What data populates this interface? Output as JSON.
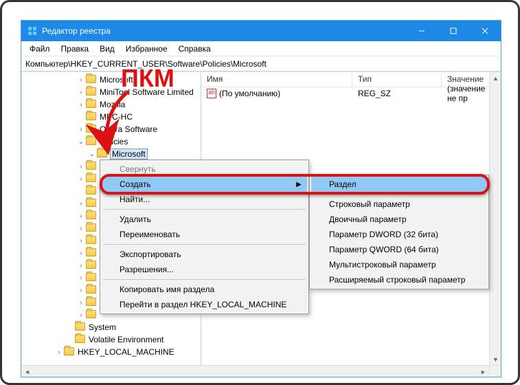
{
  "window": {
    "title": "Редактор реестра",
    "controls": {
      "minimize": "—",
      "maximize": "☐",
      "close": "✕"
    }
  },
  "menubar": [
    "Файл",
    "Правка",
    "Вид",
    "Избранное",
    "Справка"
  ],
  "address": "Компьютер\\HKEY_CURRENT_USER\\Software\\Policies\\Microsoft",
  "tree": [
    {
      "indent": 5,
      "exp": ">",
      "label": "Microsoft"
    },
    {
      "indent": 5,
      "exp": ">",
      "label": "MiniTool Software Limited"
    },
    {
      "indent": 5,
      "exp": ">",
      "label": "Mozilla"
    },
    {
      "indent": 5,
      "exp": "",
      "label": "MPC-HC"
    },
    {
      "indent": 5,
      "exp": ">",
      "label": "Opera Software"
    },
    {
      "indent": 5,
      "exp": "v",
      "label": "Policies"
    },
    {
      "indent": 6,
      "exp": "v",
      "label": "Microsoft",
      "selected": true
    },
    {
      "indent": 5,
      "exp": ">",
      "label": ""
    },
    {
      "indent": 5,
      "exp": ">",
      "label": ""
    },
    {
      "indent": 5,
      "exp": "",
      "label": ""
    },
    {
      "indent": 5,
      "exp": ">",
      "label": ""
    },
    {
      "indent": 5,
      "exp": ">",
      "label": ""
    },
    {
      "indent": 5,
      "exp": ">",
      "label": ""
    },
    {
      "indent": 5,
      "exp": ">",
      "label": ""
    },
    {
      "indent": 5,
      "exp": ">",
      "label": ""
    },
    {
      "indent": 5,
      "exp": ">",
      "label": ""
    },
    {
      "indent": 5,
      "exp": ">",
      "label": ""
    },
    {
      "indent": 5,
      "exp": ">",
      "label": ""
    },
    {
      "indent": 5,
      "exp": ">",
      "label": ""
    },
    {
      "indent": 5,
      "exp": ">",
      "label": ""
    },
    {
      "indent": 4,
      "exp": "",
      "label": "System"
    },
    {
      "indent": 4,
      "exp": "",
      "label": "Volatile Environment"
    },
    {
      "indent": 3,
      "exp": ">",
      "label": "HKEY_LOCAL_MACHINE"
    }
  ],
  "list": {
    "headers": {
      "name": "Имя",
      "type": "Тип",
      "value": "Значение"
    },
    "row": {
      "name": "(По умолчанию)",
      "type": "REG_SZ",
      "value": "(значение не пр"
    }
  },
  "context_main": {
    "items": [
      {
        "label": "Свернуть",
        "disabled": true
      },
      {
        "label": "Создать",
        "hl": true,
        "submenu": true
      },
      {
        "label": "Найти..."
      },
      {
        "sep": true
      },
      {
        "label": "Удалить"
      },
      {
        "label": "Переименовать"
      },
      {
        "sep": true
      },
      {
        "label": "Экспортировать"
      },
      {
        "label": "Разрешения..."
      },
      {
        "sep": true
      },
      {
        "label": "Копировать имя раздела"
      },
      {
        "label": "Перейти в раздел HKEY_LOCAL_MACHINE"
      }
    ]
  },
  "context_sub": {
    "items": [
      {
        "label": "Раздел",
        "hl": true
      },
      {
        "sep": true
      },
      {
        "label": "Строковый параметр"
      },
      {
        "label": "Двоичный параметр"
      },
      {
        "label": "Параметр DWORD (32 бита)"
      },
      {
        "label": "Параметр QWORD (64 бита)"
      },
      {
        "label": "Мультистроковый параметр"
      },
      {
        "label": "Расширяемый строковый параметр"
      }
    ]
  },
  "annotation": {
    "text": "ПКМ"
  }
}
